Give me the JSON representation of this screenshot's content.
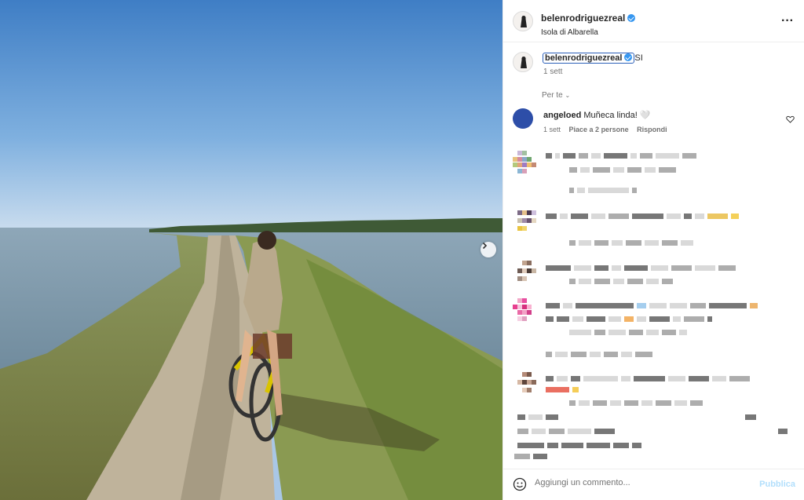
{
  "post": {
    "username": "belenrodriguezreal",
    "location": "Isola di Albarella",
    "caption_text": "SI",
    "caption_time": "1 sett",
    "sort_label": "Per te"
  },
  "comment": {
    "username": "angeloed",
    "text": "Muñeca linda! 🤍",
    "time": "1 sett",
    "likes": "Piace a 2 persone",
    "reply": "Rispondi"
  },
  "composer": {
    "placeholder": "Aggiungi un commento...",
    "publish_label": "Pubblica"
  },
  "icons": {
    "more": "more-options-icon",
    "verified": "verified-badge-icon",
    "next": "chevron-right-icon",
    "emoji": "emoji-icon",
    "like": "heart-icon"
  },
  "colors": {
    "verified": "#3797f0",
    "publish": "#b2dffc",
    "comment_avatar": "#2d4ea8"
  }
}
